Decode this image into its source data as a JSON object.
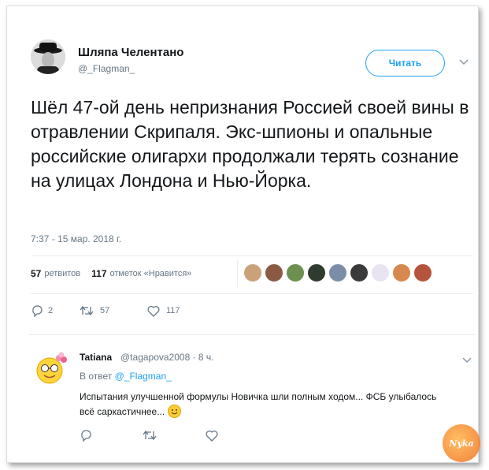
{
  "tweet": {
    "author_name": "Шляпа Челентано",
    "author_handle": "@_Flagman_",
    "follow_label": "Читать",
    "text": "Шёл 47-ой день непризнания Россией своей вины в отравлении Скрипаля. Экс-шпионы и опальные российские олигархи продолжали терять сознание на улицах Лондона и Нью-Йорка.",
    "timestamp": "7:37 - 15 мар. 2018 г.",
    "retweets_count": "57",
    "retweets_label": "ретвитов",
    "likes_count": "117",
    "likes_label": "отметок «Нравится»",
    "actions": {
      "reply_count": "2",
      "retweet_count": "57",
      "like_count": "117"
    }
  },
  "likers": [
    {
      "color": "#c9a27a"
    },
    {
      "color": "#8a5a44"
    },
    {
      "color": "#6d8f4f"
    },
    {
      "color": "#2f3b2f"
    },
    {
      "color": "#7a8ea8"
    },
    {
      "color": "#3a3a3a"
    },
    {
      "color": "#e9e4f2"
    },
    {
      "color": "#d6884f"
    },
    {
      "color": "#b5533c"
    }
  ],
  "reply": {
    "name": "Tatiana",
    "meta": "@tagapova2008 · 8 ч.",
    "reply_to_prefix": "В ответ",
    "reply_to_handle": "@_Flagman_",
    "text": "Испытания улучшенной формулы Новичка шли полным ходом...   ФСБ улыбалось всё саркастичнее..."
  },
  "watermark": "Nyka",
  "colors": {
    "accent": "#1da1f2",
    "muted": "#657786"
  },
  "icons": [
    "chevron-down-icon",
    "reply-icon",
    "retweet-icon",
    "like-icon",
    "smile-emoji-icon"
  ]
}
